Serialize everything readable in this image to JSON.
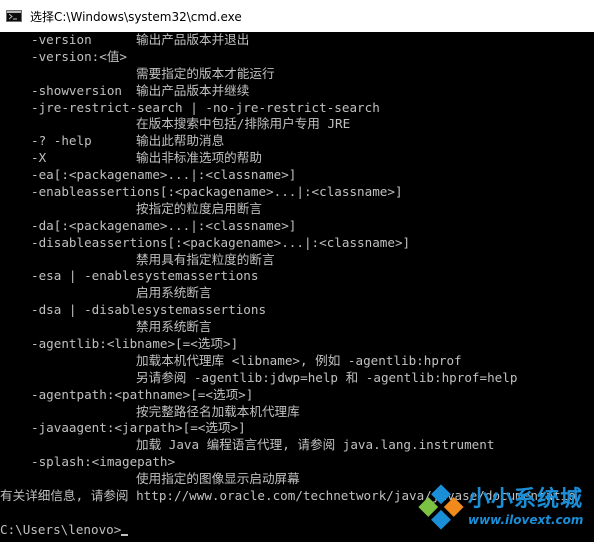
{
  "window": {
    "title": "选择C:\\Windows\\system32\\cmd.exe"
  },
  "console": {
    "lines": [
      {
        "indent": 1,
        "opt": "-version",
        "text": "输出产品版本并退出"
      },
      {
        "indent": 1,
        "opt": "-version:<值>",
        "text": ""
      },
      {
        "indent": 2,
        "opt": "",
        "text": "需要指定的版本才能运行"
      },
      {
        "indent": 1,
        "opt": "-showversion",
        "text": "输出产品版本并继续"
      },
      {
        "indent": 1,
        "opt": "-jre-restrict-search | -no-jre-restrict-search",
        "text": ""
      },
      {
        "indent": 2,
        "opt": "",
        "text": "在版本搜索中包括/排除用户专用 JRE"
      },
      {
        "indent": 1,
        "opt": "-? -help",
        "text": "输出此帮助消息"
      },
      {
        "indent": 1,
        "opt": "-X",
        "text": "输出非标准选项的帮助"
      },
      {
        "indent": 1,
        "opt": "-ea[:<packagename>...|:<classname>]",
        "text": ""
      },
      {
        "indent": 1,
        "opt": "-enableassertions[:<packagename>...|:<classname>]",
        "text": ""
      },
      {
        "indent": 2,
        "opt": "",
        "text": "按指定的粒度启用断言"
      },
      {
        "indent": 1,
        "opt": "-da[:<packagename>...|:<classname>]",
        "text": ""
      },
      {
        "indent": 1,
        "opt": "-disableassertions[:<packagename>...|:<classname>]",
        "text": ""
      },
      {
        "indent": 2,
        "opt": "",
        "text": "禁用具有指定粒度的断言"
      },
      {
        "indent": 1,
        "opt": "-esa | -enablesystemassertions",
        "text": ""
      },
      {
        "indent": 2,
        "opt": "",
        "text": "启用系统断言"
      },
      {
        "indent": 1,
        "opt": "-dsa | -disablesystemassertions",
        "text": ""
      },
      {
        "indent": 2,
        "opt": "",
        "text": "禁用系统断言"
      },
      {
        "indent": 1,
        "opt": "-agentlib:<libname>[=<选项>]",
        "text": ""
      },
      {
        "indent": 2,
        "opt": "",
        "text": "加载本机代理库 <libname>, 例如 -agentlib:hprof"
      },
      {
        "indent": 2,
        "opt": "",
        "text": "另请参阅 -agentlib:jdwp=help 和 -agentlib:hprof=help"
      },
      {
        "indent": 1,
        "opt": "-agentpath:<pathname>[=<选项>]",
        "text": ""
      },
      {
        "indent": 2,
        "opt": "",
        "text": "按完整路径名加载本机代理库"
      },
      {
        "indent": 1,
        "opt": "-javaagent:<jarpath>[=<选项>]",
        "text": ""
      },
      {
        "indent": 2,
        "opt": "",
        "text": "加载 Java 编程语言代理, 请参阅 java.lang.instrument"
      },
      {
        "indent": 1,
        "opt": "-splash:<imagepath>",
        "text": ""
      },
      {
        "indent": 2,
        "opt": "",
        "text": "使用指定的图像显示启动屏幕"
      },
      {
        "indent": 0,
        "opt": "",
        "text": "有关详细信息, 请参阅 http://www.oracle.com/technetwork/java/javase/documentatio"
      },
      {
        "indent": 0,
        "opt": "",
        "text": ""
      }
    ],
    "prompt": "C:\\Users\\lenovo>"
  },
  "watermark": {
    "cn": "小小系统城",
    "url": "www.ilovext.com"
  },
  "colors": {
    "background": "#000000",
    "text": "#c0c0c0",
    "watermark": "#1a8fd8"
  }
}
